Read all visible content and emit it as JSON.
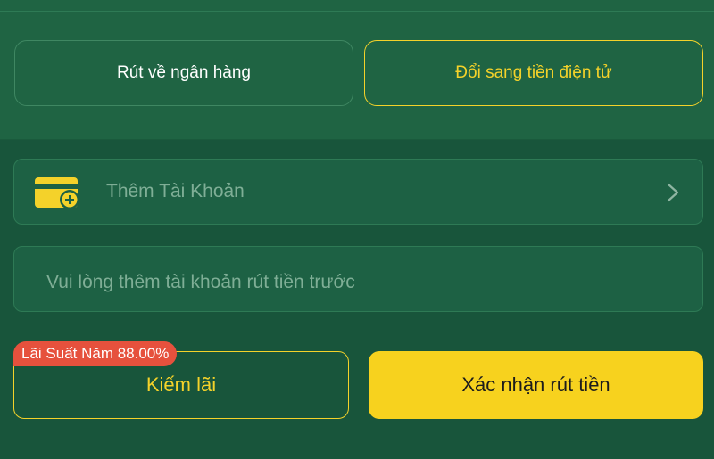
{
  "withdraw_methods": {
    "bank_label": "Rút về ngân hàng",
    "crypto_label": "Đổi sang tiền điện tử"
  },
  "account": {
    "add_label": "Thêm Tài Khoản",
    "icon": "card-add-icon"
  },
  "info": {
    "text": "Vui lòng thêm tài khoản rút tiền trước"
  },
  "actions": {
    "earn_label": "Kiếm lãi",
    "rate_badge": "Lãi Suất Năm 88.00%",
    "confirm_label": "Xác nhận rút tiền"
  },
  "colors": {
    "accent": "#f4d22a",
    "badge": "#e6513d",
    "background": "#18553b"
  }
}
